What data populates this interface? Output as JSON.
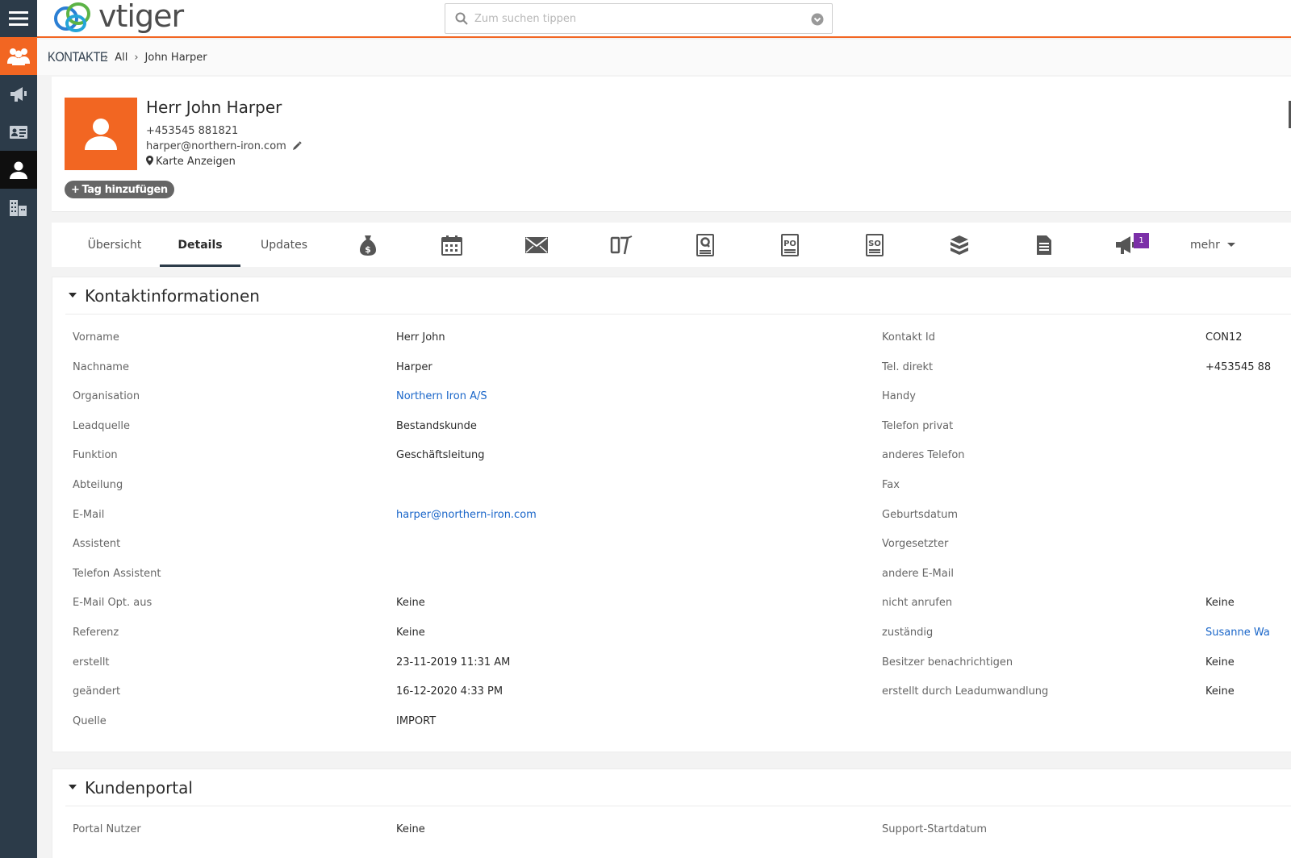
{
  "app": {
    "logo_text": "vtiger"
  },
  "search": {
    "placeholder": "Zum suchen tippen"
  },
  "breadcrumb": {
    "module": "KONTAKTE",
    "list": "All",
    "record": "John Harper"
  },
  "record": {
    "name": "Herr John Harper",
    "phone": "+453545 881821",
    "email": "harper@northern-iron.com",
    "map_link": "Karte Anzeigen",
    "add_tag": "Tag hinzufügen"
  },
  "tabs": {
    "overview": "Übersicht",
    "details": "Details",
    "updates": "Updates",
    "more": "mehr",
    "campaign_badge": "1"
  },
  "icons": {
    "rail": [
      "menu-icon",
      "contacts-module-icon",
      "campaigns-icon",
      "contact-card-icon",
      "person-icon",
      "organizations-icon"
    ],
    "tabs": [
      "money-bag-icon",
      "calendar-icon",
      "envelope-icon",
      "tickets-icon",
      "quote-icon",
      "purchase-order-icon",
      "sales-order-icon",
      "products-icon",
      "documents-icon",
      "megaphone-icon"
    ]
  },
  "colors": {
    "accent": "#f26622",
    "rail": "#2c3b49",
    "link": "#1a66c9",
    "badge": "#7b2fa8"
  },
  "section_contact": {
    "title": "Kontaktinformationen",
    "rows": [
      {
        "l1": "Vorname",
        "v1": "Herr John",
        "l2": "Kontakt Id",
        "v2": "CON12"
      },
      {
        "l1": "Nachname",
        "v1": "Harper",
        "l2": "Tel. direkt",
        "v2": "+453545 88"
      },
      {
        "l1": "Organisation",
        "v1": "Northern Iron A/S",
        "l2": "Handy",
        "v2": ""
      },
      {
        "l1": "Leadquelle",
        "v1": "Bestandskunde",
        "l2": "Telefon privat",
        "v2": ""
      },
      {
        "l1": "Funktion",
        "v1": "Geschäftsleitung",
        "l2": "anderes Telefon",
        "v2": ""
      },
      {
        "l1": "Abteilung",
        "v1": "",
        "l2": "Fax",
        "v2": ""
      },
      {
        "l1": "E-Mail",
        "v1": "harper@northern-iron.com",
        "l2": "Geburtsdatum",
        "v2": ""
      },
      {
        "l1": "Assistent",
        "v1": "",
        "l2": "Vorgesetzter",
        "v2": ""
      },
      {
        "l1": "Telefon Assistent",
        "v1": "",
        "l2": "andere E-Mail",
        "v2": ""
      },
      {
        "l1": "E-Mail Opt. aus",
        "v1": "Keine",
        "l2": "nicht anrufen",
        "v2": "Keine"
      },
      {
        "l1": "Referenz",
        "v1": "Keine",
        "l2": "zuständig",
        "v2": "Susanne Wa"
      },
      {
        "l1": "erstellt",
        "v1": "23-11-2019 11:31 AM",
        "l2": "Besitzer benachrichtigen",
        "v2": "Keine"
      },
      {
        "l1": "geändert",
        "v1": "16-12-2020 4:33 PM",
        "l2": "erstellt durch Leadumwandlung",
        "v2": "Keine"
      },
      {
        "l1": "Quelle",
        "v1": "IMPORT",
        "l2": "",
        "v2": ""
      }
    ]
  },
  "section_portal": {
    "title": "Kundenportal",
    "rows": [
      {
        "l1": "Portal Nutzer",
        "v1": "Keine",
        "l2": "Support-Startdatum",
        "v2": ""
      }
    ]
  }
}
